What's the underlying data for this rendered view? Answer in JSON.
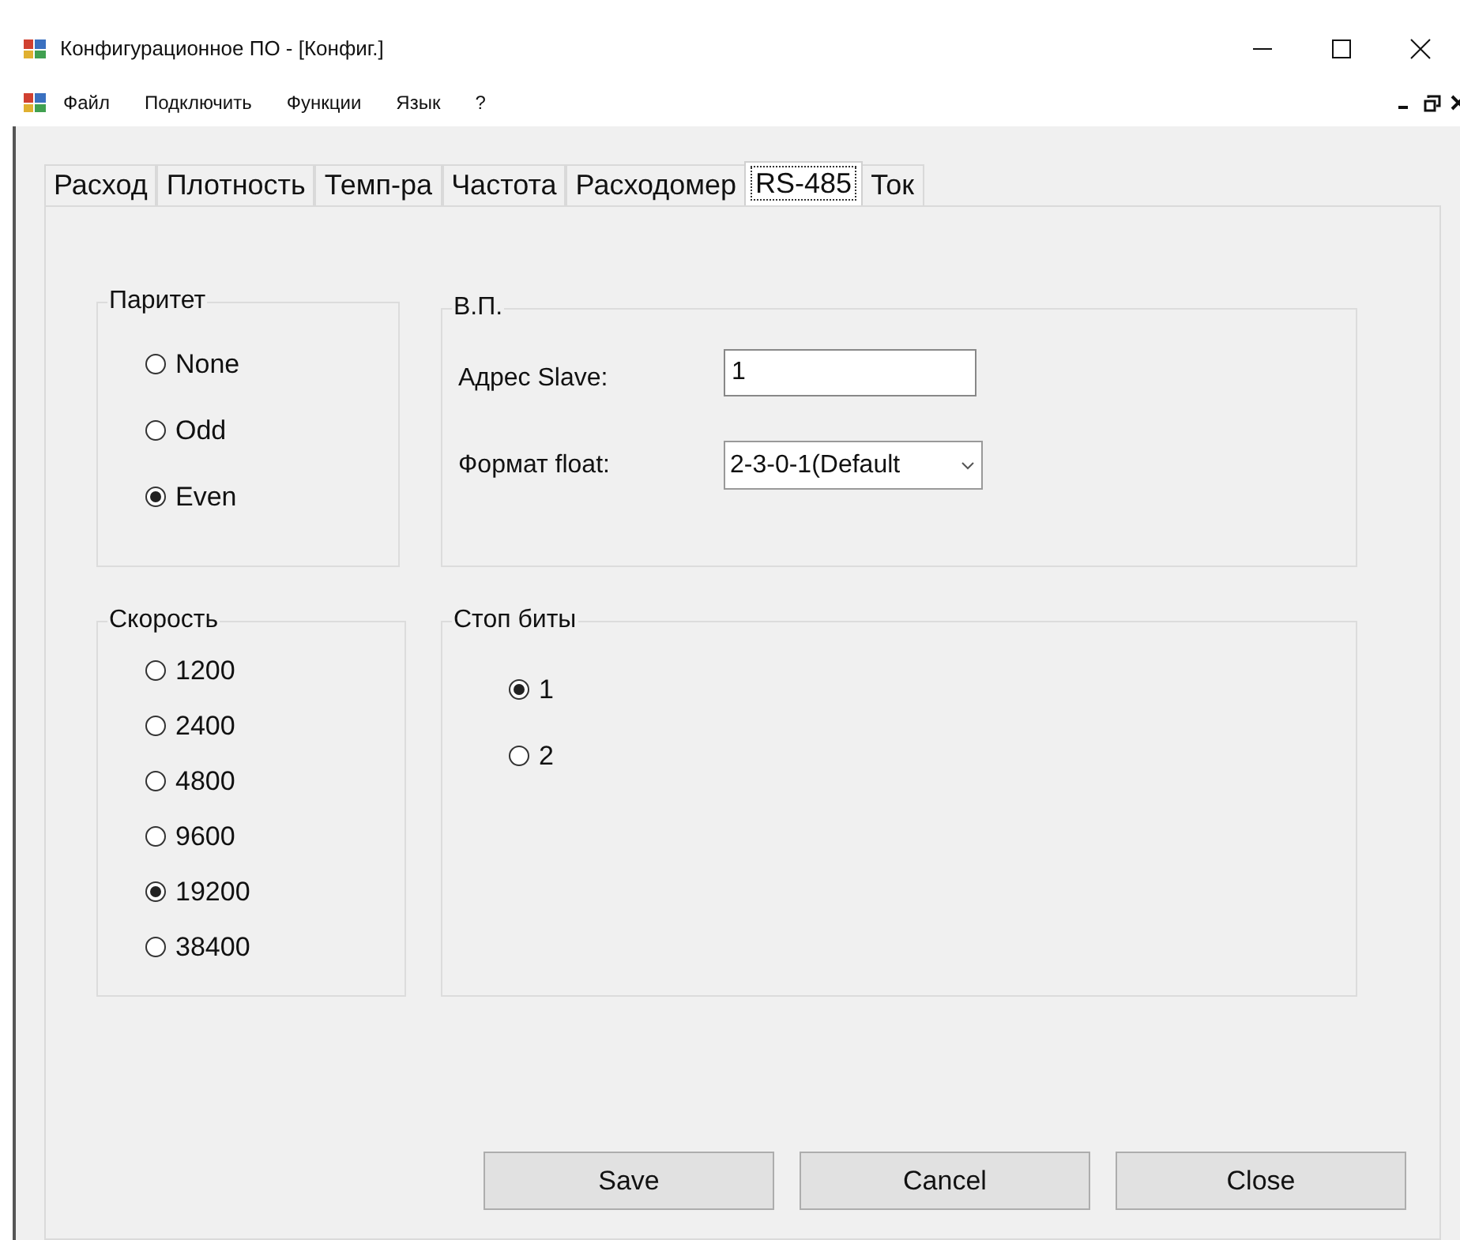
{
  "window": {
    "title": "Конфигурационное ПО - [Конфиг.]"
  },
  "menu": [
    "Файл",
    "Подключить",
    "Функции",
    "Язык",
    "?"
  ],
  "tabs": [
    {
      "label": "Расход",
      "selected": false
    },
    {
      "label": "Плотность",
      "selected": false
    },
    {
      "label": "Темп-ра",
      "selected": false
    },
    {
      "label": "Частота",
      "selected": false
    },
    {
      "label": "Расходомер",
      "selected": false
    },
    {
      "label": "RS-485",
      "selected": true
    },
    {
      "label": "Ток",
      "selected": false
    }
  ],
  "parity": {
    "title": "Паритет",
    "options": [
      {
        "label": "None",
        "selected": false
      },
      {
        "label": "Odd",
        "selected": false
      },
      {
        "label": "Even",
        "selected": true
      }
    ]
  },
  "vp": {
    "title": "В.П.",
    "slave_address": {
      "label": "Адрес Slave:",
      "value": "1"
    },
    "float_format": {
      "label": "Формат float:",
      "value": "2-3-0-1(Default"
    }
  },
  "speed": {
    "title": "Скорость",
    "options": [
      {
        "label": "1200",
        "selected": false
      },
      {
        "label": "2400",
        "selected": false
      },
      {
        "label": "4800",
        "selected": false
      },
      {
        "label": "9600",
        "selected": false
      },
      {
        "label": "19200",
        "selected": true
      },
      {
        "label": "38400",
        "selected": false
      }
    ]
  },
  "stop_bits": {
    "title": "Стоп биты",
    "options": [
      {
        "label": "1",
        "selected": true
      },
      {
        "label": "2",
        "selected": false
      }
    ]
  },
  "buttons": [
    "Save",
    "Cancel",
    "Close"
  ]
}
